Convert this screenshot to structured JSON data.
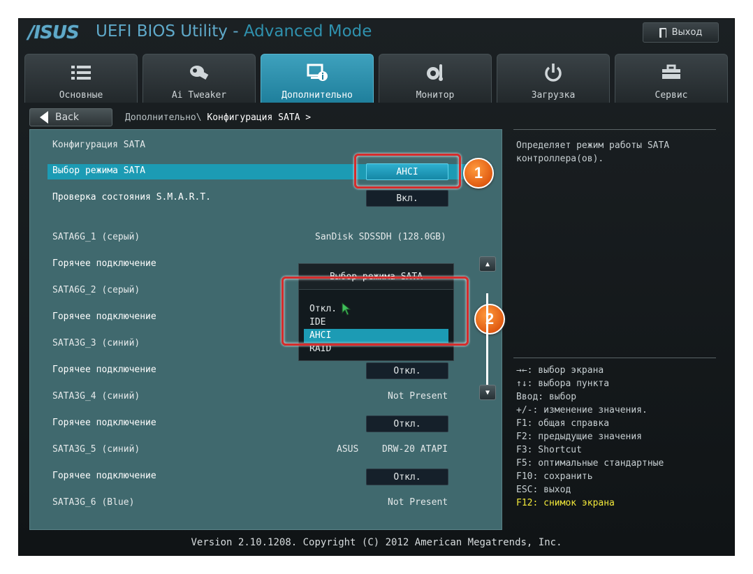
{
  "header": {
    "logo": "/ISUS",
    "title_main": "UEFI BIOS Utility - ",
    "title_mode": "Advanced Mode",
    "exit_label": "Выход"
  },
  "tabs": [
    {
      "label": "Основные",
      "icon": "list-icon"
    },
    {
      "label": "Ai Tweaker",
      "icon": "tweaker-icon"
    },
    {
      "label": "Дополнительно",
      "icon": "advanced-icon",
      "active": true
    },
    {
      "label": "Монитор",
      "icon": "monitor-icon"
    },
    {
      "label": "Загрузка",
      "icon": "power-icon"
    },
    {
      "label": "Сервис",
      "icon": "toolbox-icon"
    }
  ],
  "nav": {
    "back_label": "Back",
    "breadcrumb_parent": "Дополнительно\\ ",
    "breadcrumb_current": "Конфигурация SATA >"
  },
  "settings": {
    "section_title": "Конфигурация SATA",
    "sata_mode_label": "Выбор режима SATA",
    "sata_mode_value": "AHCI",
    "smart_label": "Проверка состояния S.M.A.R.T.",
    "smart_value": "Вкл.",
    "ports": [
      {
        "name": "SATA6G_1 (серый)",
        "device": "SanDisk SDSSDH (128.0GB)",
        "hotplug_label": "Горячее подключение"
      },
      {
        "name": "SATA6G_2 (серый)",
        "hotplug_label": "Горячее подключение"
      },
      {
        "name": "SATA3G_3 (синий)",
        "hotplug_label": "Горячее подключение",
        "hotplug_value": "Откл."
      },
      {
        "name": "SATA3G_4 (синий)",
        "device": "Not Present",
        "hotplug_label": "Горячее подключение",
        "hotplug_value": "Откл."
      },
      {
        "name": "SATA3G_5 (синий)",
        "device_vendor": "ASUS",
        "device": "DRW-20 ATAPI",
        "hotplug_label": "Горячее подключение",
        "hotplug_value": "Откл."
      },
      {
        "name": "SATA3G_6 (Blue)",
        "device": "Not Present"
      }
    ]
  },
  "popup": {
    "title": "Выбор режима SATA",
    "options": [
      "Откл.",
      "IDE",
      "AHCI",
      "RAID"
    ],
    "selected": "AHCI"
  },
  "annotations": {
    "badge1": "1",
    "badge2": "2",
    "color": "#d62c2c"
  },
  "help": {
    "description": "Определяет режим работы SATA контроллера(ов).",
    "keys": [
      "→←: выбор экрана",
      "↑↓: выбора пункта",
      "Ввод: выбор",
      "+/-: изменение значения.",
      "F1: общая справка",
      "F2: предыдущие значения",
      "F3: Shortcut",
      "F5: оптимальные стандартные",
      "F10: сохранить",
      "ESC: выход",
      "F12: снимок экрана"
    ]
  },
  "footer": "Version 2.10.1208. Copyright (C) 2012 American Megatrends, Inc.",
  "colors": {
    "accent": "#1c9bb4",
    "panel": "#40696e",
    "hotkey": "#f3e93a"
  }
}
